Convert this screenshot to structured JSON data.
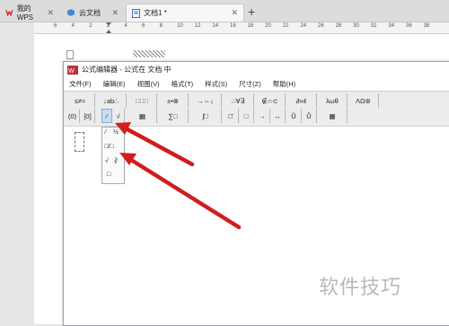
{
  "tabs": [
    {
      "label": "我的WPS",
      "icon": "wps-logo-icon"
    },
    {
      "label": "云文档",
      "icon": "cloud-doc-icon"
    },
    {
      "label": "文档1 *",
      "icon": "document-icon",
      "active": true
    }
  ],
  "ruler": {
    "numbers": [
      "6",
      "4",
      "2",
      "2",
      "4",
      "6",
      "8",
      "10",
      "12",
      "14",
      "16",
      "18",
      "20",
      "22",
      "24",
      "26",
      "28",
      "30",
      "32",
      "34",
      "36",
      "38"
    ]
  },
  "equation_editor": {
    "title": "公式编辑器 - 公式在 文档 中",
    "menu": [
      "文件(F)",
      "编辑(E)",
      "视图(V)",
      "格式(T)",
      "样式(S)",
      "尺寸(Z)",
      "帮助(H)"
    ],
    "toolbar_row1": [
      "≤≠≈",
      "↓ab∴",
      "∷∷∷",
      "±•⊗",
      "→⇔↓",
      "∴∀∃",
      "∉∩⊂",
      "∂∞ℓ",
      "λωθ",
      "ΛΩ⊛"
    ],
    "toolbar_row2": [
      "(0)",
      "[0]",
      "⁄",
      "√",
      "▦",
      "∑□",
      "∫□",
      "□̄",
      "□",
      "→",
      "↔",
      "Ũ",
      "Ů",
      "▦"
    ],
    "dropdown_items": [
      "⁄",
      "½",
      "□/□",
      "√",
      "∛",
      "□"
    ]
  },
  "watermark": "软件技巧",
  "accent": "#d9242b",
  "arrow_color": "#d11d1d"
}
